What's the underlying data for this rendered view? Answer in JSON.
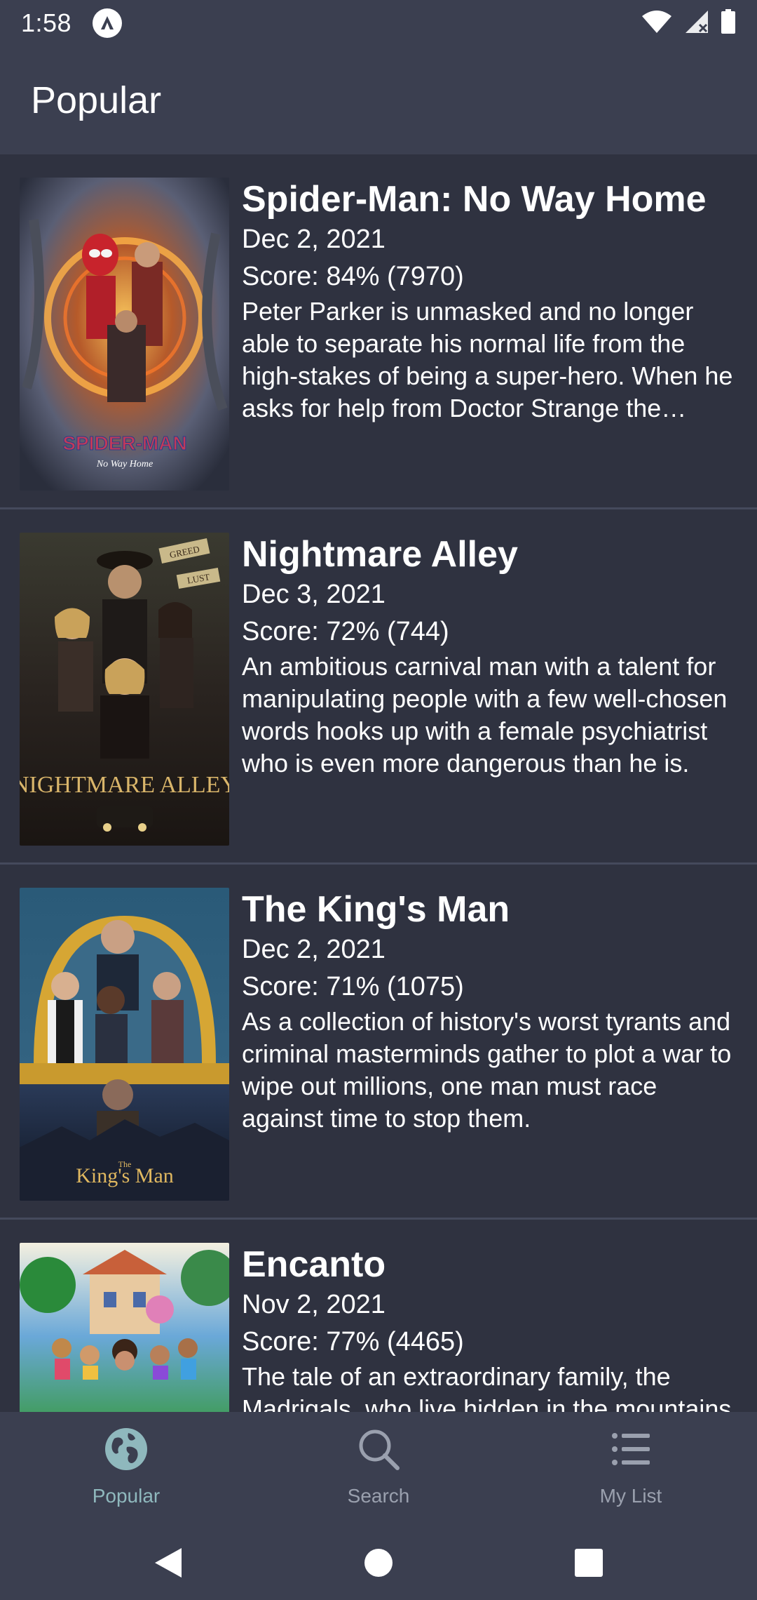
{
  "status_bar": {
    "time": "1:58"
  },
  "app_bar": {
    "title": "Popular"
  },
  "movies": [
    {
      "title": "Spider-Man: No Way Home",
      "date": "Dec 2, 2021",
      "score": "Score: 84% (7970)",
      "overview": "Peter Parker is unmasked and no longer able to separate his normal life from the high-stakes of being a super-hero. When he asks for help from Doctor Strange the stakes become even more dangerous.",
      "poster_text": "SPIDER-MAN",
      "poster_subtext": "No Way Home"
    },
    {
      "title": "Nightmare Alley",
      "date": "Dec 3, 2021",
      "score": "Score: 72% (744)",
      "overview": "An ambitious carnival man with a talent for manipulating people with a few well-chosen words hooks up with a female psychiatrist who is even more dangerous than he is.",
      "poster_text": "NIGHTMARE ALLEY",
      "poster_tag_1": "GREED",
      "poster_tag_2": "LUST"
    },
    {
      "title": "The King's Man",
      "date": "Dec 2, 2021",
      "score": "Score: 71% (1075)",
      "overview": "As a collection of history's worst tyrants and criminal masterminds gather to plot a war to wipe out millions, one man must race against time to stop them.",
      "poster_text": "King's Man",
      "poster_small": "The"
    },
    {
      "title": "Encanto",
      "date": "Nov 2, 2021",
      "score": "Score: 77% (4465)",
      "overview": "The tale of an extraordinary family, the Madrigals, who live hidden in the mountains of Colombia."
    }
  ],
  "bottom_nav": {
    "items": [
      {
        "label": "Popular",
        "icon": "globe-icon",
        "active": true
      },
      {
        "label": "Search",
        "icon": "search-icon",
        "active": false
      },
      {
        "label": "My List",
        "icon": "list-icon",
        "active": false
      }
    ]
  },
  "colors": {
    "background": "#2f3240",
    "bar": "#3b3f50",
    "divider": "#454a5c",
    "active_nav": "#8fb8bd",
    "inactive_nav": "#9aa0ae"
  }
}
